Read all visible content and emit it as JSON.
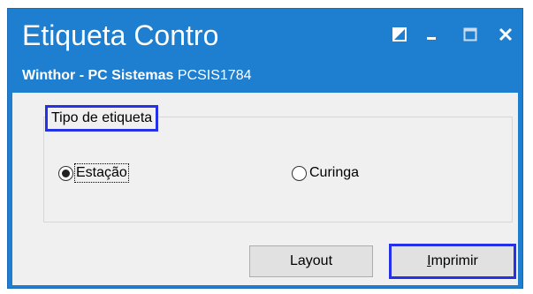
{
  "window": {
    "title": "Etiqueta Contro",
    "subtitle_brand": "Winthor - PC Sistemas",
    "subtitle_code": "PCSIS1784",
    "controls": {
      "restore_icon": "restore-icon",
      "minimize_icon": "minimize-icon",
      "maximize_icon": "maximize-icon",
      "close_icon": "close-icon"
    }
  },
  "group": {
    "legend": "Tipo de etiqueta",
    "options": [
      {
        "label": "Estação",
        "selected": true
      },
      {
        "label": "Curinga",
        "selected": false
      }
    ]
  },
  "buttons": {
    "layout": "Layout",
    "print_first": "I",
    "print_rest": "mprimir"
  },
  "colors": {
    "titlebar": "#1e7ed0",
    "highlight": "#2431e8"
  }
}
